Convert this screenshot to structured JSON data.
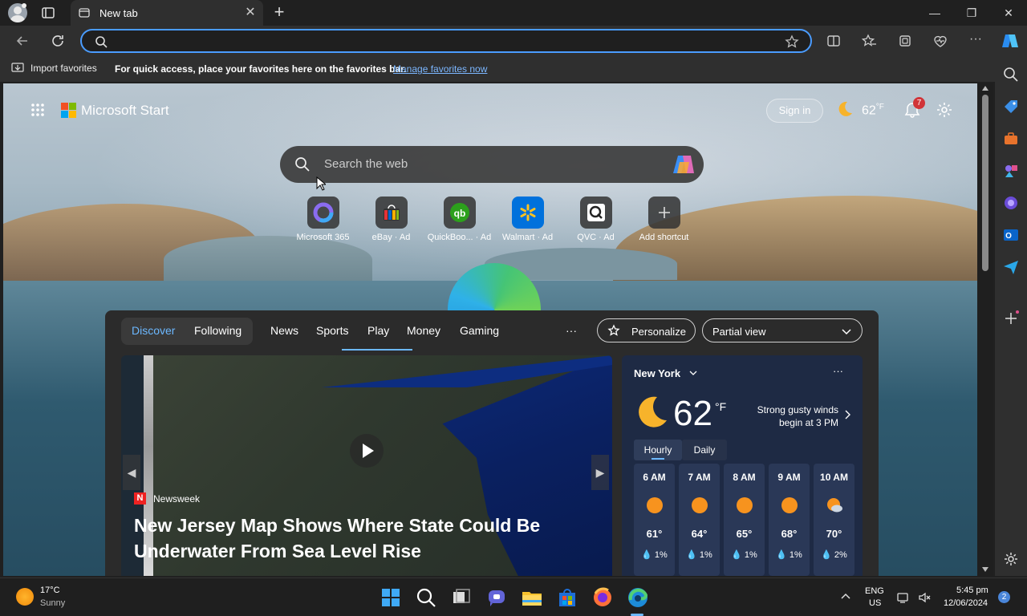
{
  "browser": {
    "tab_title": "New tab",
    "favorites_bar": {
      "import_label": "Import favorites",
      "message": "For quick access, place your favorites here on the favorites bar.",
      "link": "Manage favorites now"
    },
    "accent_color": "#4a9cff"
  },
  "start": {
    "brand": "Microsoft Start",
    "sign_in": "Sign in",
    "header_temp": "62",
    "header_unit": "°F",
    "notification_count": "7",
    "search_placeholder": "Search the web",
    "shortcuts": [
      {
        "label": "Microsoft 365",
        "icon": "microsoft-365-icon"
      },
      {
        "label": "eBay · Ad",
        "icon": "ebay-icon"
      },
      {
        "label": "QuickBoo... · Ad",
        "icon": "quickbooks-icon"
      },
      {
        "label": "Walmart · Ad",
        "icon": "walmart-icon"
      },
      {
        "label": "QVC · Ad",
        "icon": "qvc-icon"
      },
      {
        "label": "Add shortcut",
        "icon": "plus-icon"
      }
    ]
  },
  "feed": {
    "tabs": [
      "Discover",
      "Following",
      "News",
      "Sports",
      "Play",
      "Money",
      "Gaming"
    ],
    "more": "···",
    "personalize": "Personalize",
    "view_mode": "Partial view",
    "story": {
      "source": "Newsweek",
      "headline": "New Jersey Map Shows Where State Could Be Underwater From Sea Level Rise"
    },
    "weather": {
      "city": "New York",
      "temp": "62",
      "unit": "°F",
      "alert": "Strong gusty winds begin at 3 PM",
      "tab_hourly": "Hourly",
      "tab_daily": "Daily",
      "hours": [
        {
          "time": "6 AM",
          "temp": "61°",
          "precip": "1%",
          "icon": "sun-icon"
        },
        {
          "time": "7 AM",
          "temp": "64°",
          "precip": "1%",
          "icon": "sun-icon"
        },
        {
          "time": "8 AM",
          "temp": "65°",
          "precip": "1%",
          "icon": "sun-icon"
        },
        {
          "time": "9 AM",
          "temp": "68°",
          "precip": "1%",
          "icon": "sun-icon"
        },
        {
          "time": "10 AM",
          "temp": "70°",
          "precip": "2%",
          "icon": "partly-cloudy-icon"
        }
      ]
    }
  },
  "taskbar": {
    "weather_temp": "17°C",
    "weather_desc": "Sunny",
    "lang": "ENG",
    "region": "US",
    "time": "5:45 pm",
    "date": "12/06/2024",
    "notification_count": "2"
  }
}
